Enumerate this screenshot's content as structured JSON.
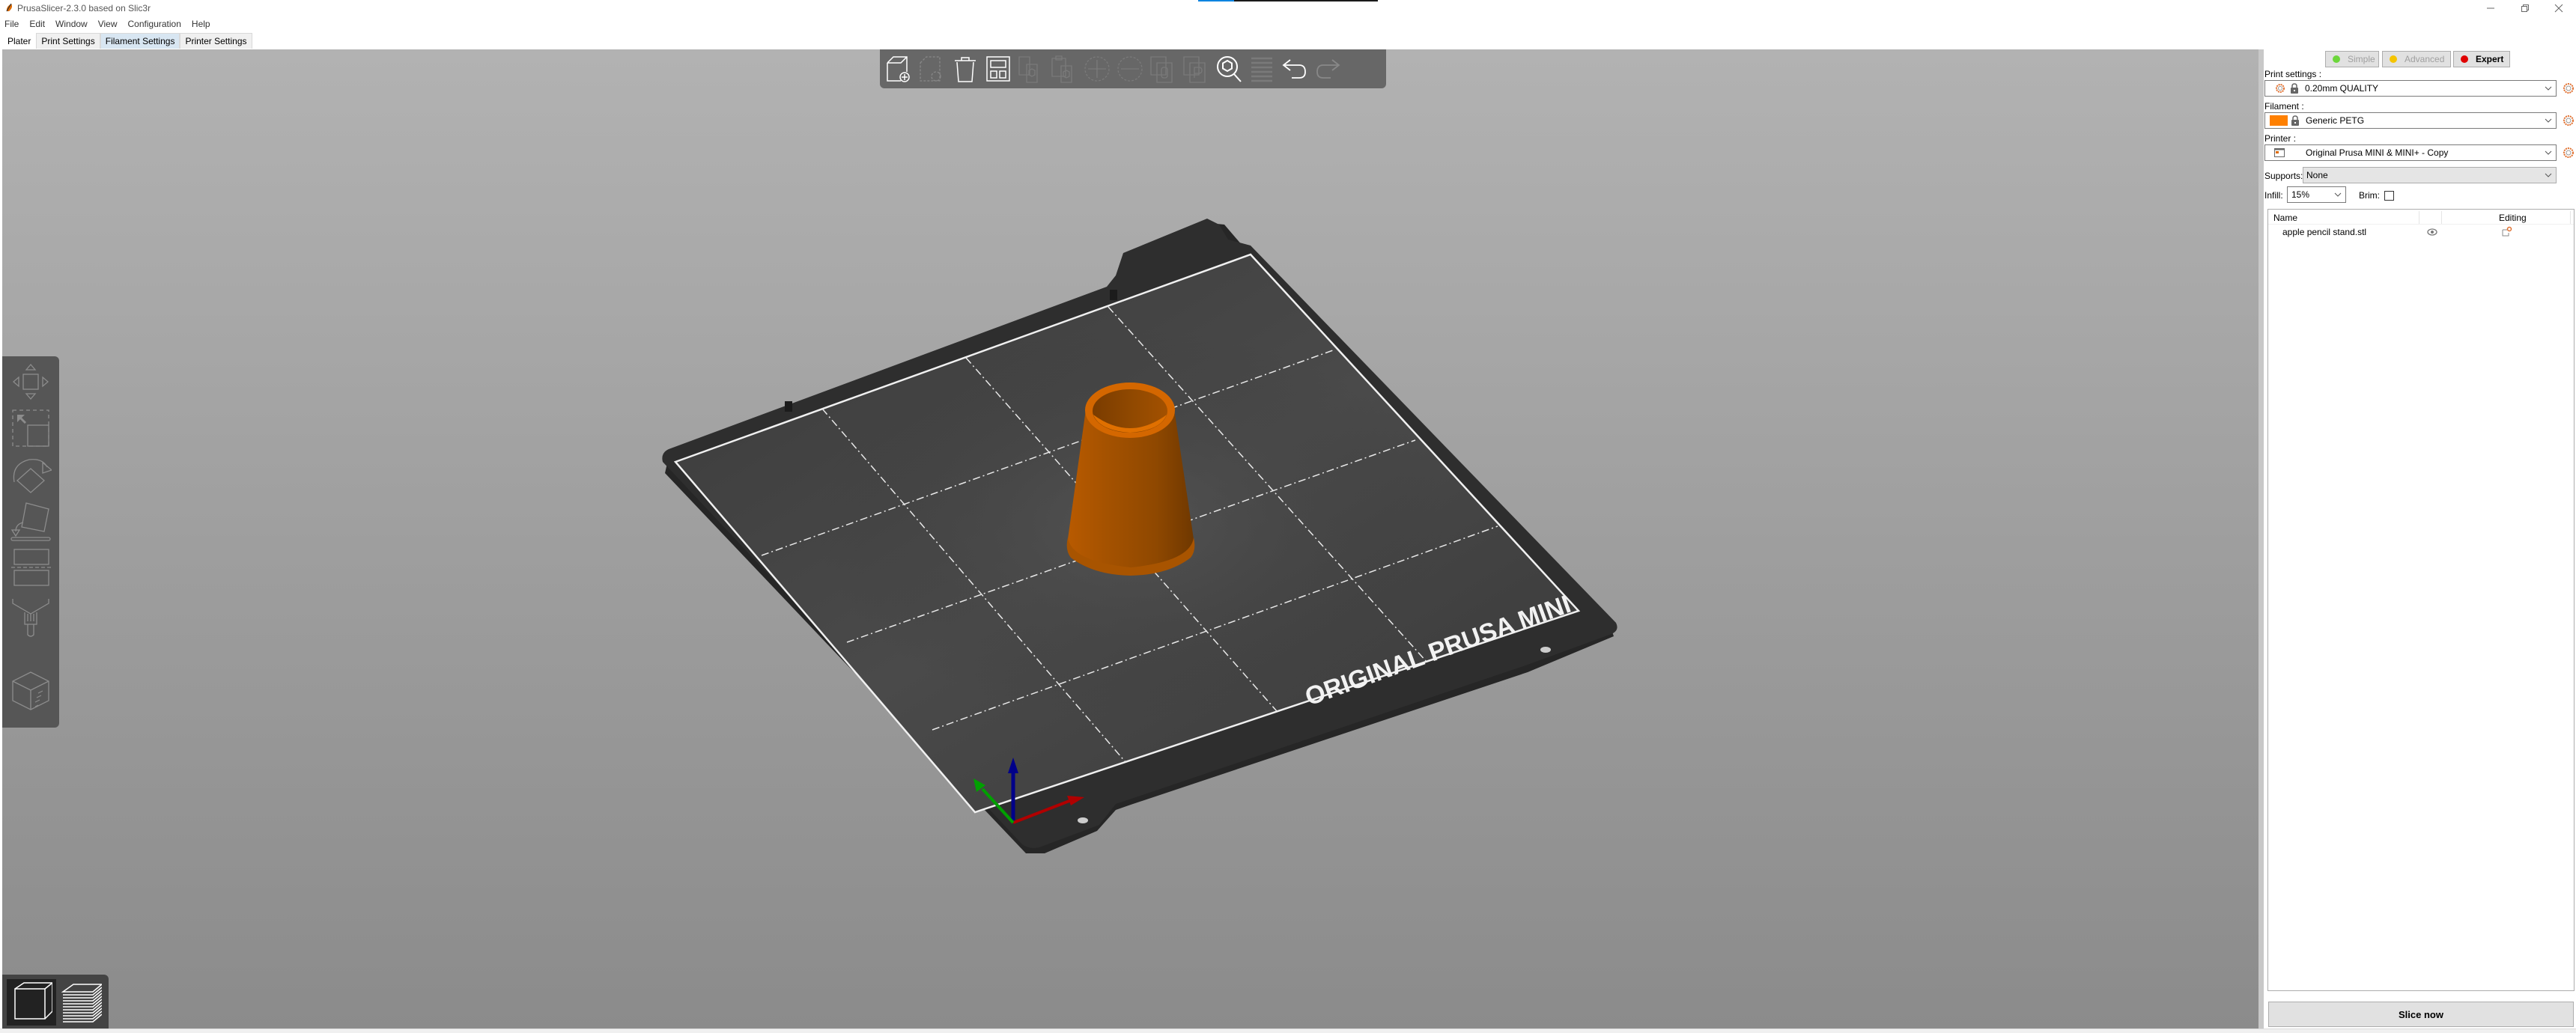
{
  "window": {
    "title": "PrusaSlicer-2.3.0 based on Slic3r",
    "controls": [
      "minimize",
      "restore",
      "close"
    ],
    "progress_fraction": 0.2
  },
  "menu": [
    "File",
    "Edit",
    "Window",
    "View",
    "Configuration",
    "Help"
  ],
  "tabs": [
    {
      "label": "Plater",
      "state": "active"
    },
    {
      "label": "Print Settings",
      "state": "normal"
    },
    {
      "label": "Filament Settings",
      "state": "highlight"
    },
    {
      "label": "Printer Settings",
      "state": "normal"
    }
  ],
  "top_toolbar": [
    {
      "icon": "add-object-icon",
      "enabled": true
    },
    {
      "icon": "delete-object-icon",
      "enabled": false
    },
    {
      "icon": "delete-all-icon",
      "enabled": true
    },
    {
      "icon": "arrange-icon",
      "enabled": true
    },
    {
      "icon": "copy-icon",
      "enabled": false
    },
    {
      "icon": "paste-icon",
      "enabled": false
    },
    {
      "icon": "add-instance-icon",
      "enabled": false
    },
    {
      "icon": "remove-instance-icon",
      "enabled": false
    },
    {
      "icon": "split-objects-icon",
      "enabled": false
    },
    {
      "icon": "split-parts-icon",
      "enabled": false
    },
    {
      "icon": "search-icon",
      "enabled": true
    },
    {
      "icon": "layers-editing-icon",
      "enabled": false
    },
    {
      "icon": "undo-icon",
      "enabled": true
    },
    {
      "icon": "redo-icon",
      "enabled": false
    }
  ],
  "left_toolbar": [
    "move-icon",
    "scale-icon",
    "rotate-icon",
    "place-on-face-icon",
    "cut-icon",
    "paint-supports-icon",
    "seam-painting-icon"
  ],
  "view_toolbar": [
    "3d-view-icon",
    "preview-layers-icon"
  ],
  "bed": {
    "label": "ORIGINAL PRUSA MINI",
    "axis_colors": {
      "x": "#c00000",
      "y": "#00a000",
      "z": "#000090"
    }
  },
  "model": {
    "name": "apple pencil stand.stl",
    "color": "#e06b00"
  },
  "sidebar": {
    "modes": [
      {
        "label": "Simple",
        "color": "#6cd63b",
        "active": false
      },
      {
        "label": "Advanced",
        "color": "#f5c400",
        "active": false
      },
      {
        "label": "Expert",
        "color": "#e00000",
        "active": true
      }
    ],
    "print_settings_label": "Print settings :",
    "print_settings_value": "0.20mm QUALITY",
    "filament_label": "Filament :",
    "filament_value": "Generic PETG",
    "filament_color": "#ff8000",
    "printer_label": "Printer :",
    "printer_value": "Original Prusa MINI & MINI+ - Copy",
    "supports_label": "Supports:",
    "supports_value": "None",
    "infill_label": "Infill:",
    "infill_value": "15%",
    "brim_label": "Brim:",
    "brim_checked": false,
    "object_list": {
      "col_name": "Name",
      "col_editing": "Editing",
      "items": [
        {
          "name": "apple pencil stand.stl",
          "visible": true
        }
      ]
    },
    "slice_button": "Slice now"
  }
}
